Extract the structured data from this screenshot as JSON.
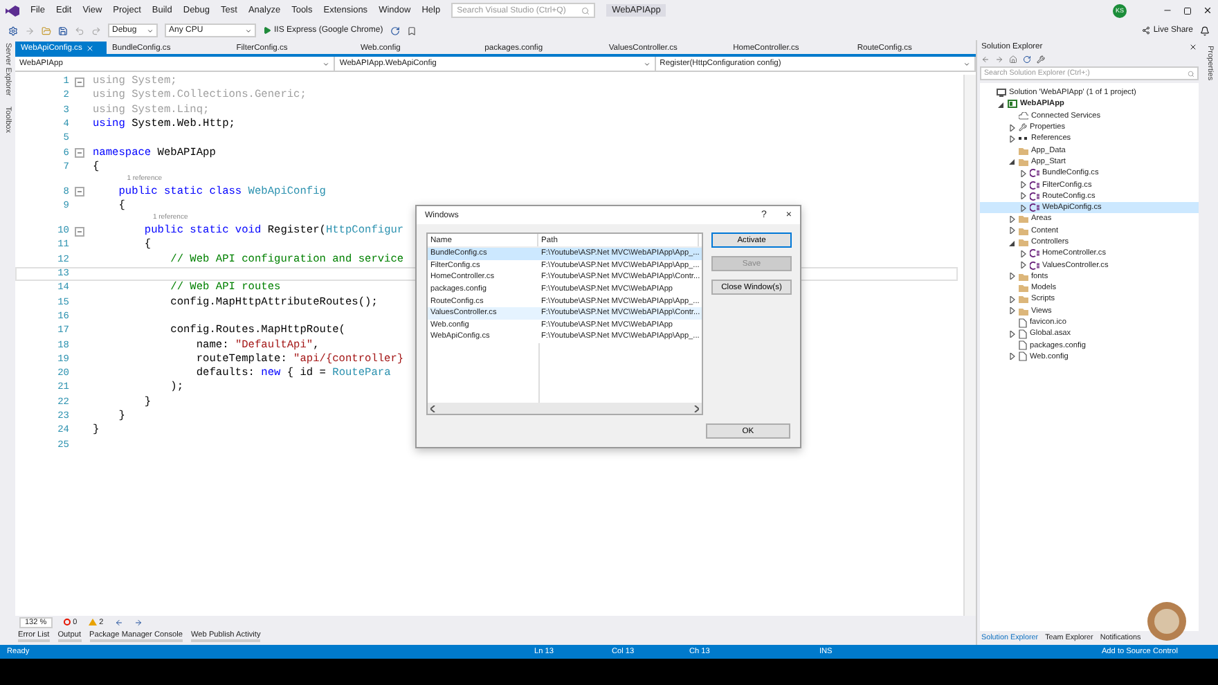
{
  "menu": [
    "File",
    "Edit",
    "View",
    "Project",
    "Build",
    "Debug",
    "Test",
    "Analyze",
    "Tools",
    "Extensions",
    "Window",
    "Help"
  ],
  "search": {
    "placeholder": "Search Visual Studio (Ctrl+Q)"
  },
  "window": {
    "title": "WebAPIApp"
  },
  "account": {
    "initials": "KS"
  },
  "live_share": "Live Share",
  "toolbar": {
    "configuration": "Debug",
    "platform": "Any CPU",
    "run": "IIS Express (Google Chrome)"
  },
  "side_tabs": [
    "Server Explorer",
    "Toolbox"
  ],
  "right_side_tabs": [
    "Properties"
  ],
  "tabs": [
    {
      "label": "WebApiConfig.cs",
      "selected": true
    },
    {
      "label": "BundleConfig.cs",
      "selected": false
    },
    {
      "label": "FilterConfig.cs",
      "selected": false
    },
    {
      "label": "Web.config",
      "selected": false
    },
    {
      "label": "packages.config",
      "selected": false
    },
    {
      "label": "ValuesController.cs",
      "selected": false
    },
    {
      "label": "HomeController.cs",
      "selected": false
    },
    {
      "label": "RouteConfig.cs",
      "selected": false
    }
  ],
  "nav_bar": {
    "project": "WebAPIApp",
    "type": "WebAPIApp.WebApiConfig",
    "member": "Register(HttpConfiguration config)"
  },
  "code": [
    {
      "n": "1",
      "fold": true,
      "segs": [
        {
          "t": "using System;",
          "kind": "dim"
        }
      ]
    },
    {
      "n": "2",
      "segs": [
        {
          "t": "using System.Collections.Generic;",
          "kind": "dim"
        }
      ]
    },
    {
      "n": "3",
      "segs": [
        {
          "t": "using System.Linq;",
          "kind": "dim"
        }
      ]
    },
    {
      "n": "4",
      "segs": [
        {
          "t": "using",
          "kind": "kw"
        },
        {
          "t": " System.Web.Http;",
          "kind": "plain"
        }
      ]
    },
    {
      "n": "5"
    },
    {
      "n": "6",
      "fold": true,
      "segs": [
        {
          "t": "namespace",
          "kind": "kw"
        },
        {
          "t": " WebAPIApp",
          "kind": "plain"
        }
      ]
    },
    {
      "n": "7",
      "segs": [
        {
          "t": "{",
          "kind": "plain"
        }
      ]
    },
    {
      "n": "8",
      "fold": true,
      "ref": "1 reference",
      "segs": [
        {
          "t": "    public static class ",
          "kind": "kw"
        },
        {
          "t": "WebApiConfig",
          "kind": "type"
        }
      ]
    },
    {
      "n": "9",
      "segs": [
        {
          "t": "    {",
          "kind": "plain"
        }
      ]
    },
    {
      "n": "10",
      "fold": true,
      "ref": "1 reference",
      "segs": [
        {
          "t": "        public static void",
          "kind": "kw"
        },
        {
          "t": " Register(",
          "kind": "plain"
        },
        {
          "t": "HttpConfigur",
          "kind": "type"
        }
      ]
    },
    {
      "n": "11",
      "segs": [
        {
          "t": "        {",
          "kind": "plain"
        }
      ]
    },
    {
      "n": "12",
      "segs": [
        {
          "t": "            // Web API configuration and service",
          "kind": "comment"
        }
      ]
    },
    {
      "n": "13",
      "current": true
    },
    {
      "n": "14",
      "segs": [
        {
          "t": "            // Web API routes",
          "kind": "comment"
        }
      ]
    },
    {
      "n": "15",
      "segs": [
        {
          "t": "            config.MapHttpAttributeRoutes();",
          "kind": "plain"
        }
      ]
    },
    {
      "n": "16"
    },
    {
      "n": "17",
      "segs": [
        {
          "t": "            config.Routes.MapHttpRoute(",
          "kind": "plain"
        }
      ]
    },
    {
      "n": "18",
      "segs": [
        {
          "t": "                name: ",
          "kind": "plain"
        },
        {
          "t": "\"DefaultApi\"",
          "kind": "string"
        },
        {
          "t": ",",
          "kind": "plain"
        }
      ]
    },
    {
      "n": "19",
      "segs": [
        {
          "t": "                routeTemplate: ",
          "kind": "plain"
        },
        {
          "t": "\"api/{controller}",
          "kind": "string"
        }
      ]
    },
    {
      "n": "20",
      "segs": [
        {
          "t": "                defaults: ",
          "kind": "plain"
        },
        {
          "t": "new",
          "kind": "kw"
        },
        {
          "t": " { id = ",
          "kind": "plain"
        },
        {
          "t": "RoutePara",
          "kind": "type"
        }
      ]
    },
    {
      "n": "21",
      "segs": [
        {
          "t": "            );",
          "kind": "plain"
        }
      ]
    },
    {
      "n": "22",
      "segs": [
        {
          "t": "        }",
          "kind": "plain"
        }
      ]
    },
    {
      "n": "23",
      "segs": [
        {
          "t": "    }",
          "kind": "plain"
        }
      ]
    },
    {
      "n": "24",
      "segs": [
        {
          "t": "}",
          "kind": "plain"
        }
      ]
    },
    {
      "n": "25"
    }
  ],
  "dialog": {
    "title": "Windows",
    "help": "?",
    "close": "×",
    "columns": [
      "Name",
      "Path"
    ],
    "rows": [
      {
        "name": "BundleConfig.cs",
        "path": "F:\\Youtube\\ASP.Net MVC\\WebAPIApp\\App_...",
        "selected": true,
        "hovered": false
      },
      {
        "name": "FilterConfig.cs",
        "path": "F:\\Youtube\\ASP.Net MVC\\WebAPIApp\\App_...",
        "selected": false,
        "hovered": false
      },
      {
        "name": "HomeController.cs",
        "path": "F:\\Youtube\\ASP.Net MVC\\WebAPIApp\\Contr...",
        "selected": false,
        "hovered": false
      },
      {
        "name": "packages.config",
        "path": "F:\\Youtube\\ASP.Net MVC\\WebAPIApp",
        "selected": false,
        "hovered": false
      },
      {
        "name": "RouteConfig.cs",
        "path": "F:\\Youtube\\ASP.Net MVC\\WebAPIApp\\App_...",
        "selected": false,
        "hovered": false
      },
      {
        "name": "ValuesController.cs",
        "path": "F:\\Youtube\\ASP.Net MVC\\WebAPIApp\\Contr...",
        "selected": false,
        "hovered": true
      },
      {
        "name": "Web.config",
        "path": "F:\\Youtube\\ASP.Net MVC\\WebAPIApp",
        "selected": false,
        "hovered": false
      },
      {
        "name": "WebApiConfig.cs",
        "path": "F:\\Youtube\\ASP.Net MVC\\WebAPIApp\\App_...",
        "selected": false,
        "hovered": false
      }
    ],
    "buttons": [
      {
        "label": "Activate",
        "disabled": false,
        "default": true
      },
      {
        "label": "Save",
        "disabled": true,
        "default": false
      },
      {
        "label": "Close Window(s)",
        "disabled": false,
        "default": false
      }
    ],
    "ok": "OK"
  },
  "editor_status": {
    "zoom": "132 %",
    "errors": "0",
    "warnings": "2"
  },
  "bottom_tabs": [
    "Error List",
    "Output",
    "Package Manager Console",
    "Web Publish Activity"
  ],
  "solution_explorer": {
    "title": "Solution Explorer",
    "search": {
      "placeholder": "Search Solution Explorer (Ctrl+;)"
    },
    "tree": [
      {
        "label": "Solution 'WebAPIApp' (1 of 1 project)",
        "kind": "solution",
        "selected": false,
        "children": [
          {
            "label": "WebAPIApp",
            "kind": "project",
            "bold": true,
            "expanded": true,
            "selected": false,
            "children": [
              {
                "label": "Connected Services",
                "kind": "connected",
                "selected": false
              },
              {
                "label": "Properties",
                "kind": "wrench",
                "expanded": false,
                "selected": false
              },
              {
                "label": "References",
                "kind": "references",
                "expanded": false,
                "selected": false
              },
              {
                "label": "App_Data",
                "kind": "folder",
                "selected": false
              },
              {
                "label": "App_Start",
                "kind": "openfolder",
                "expanded": true,
                "selected": false,
                "children": [
                  {
                    "label": "BundleConfig.cs",
                    "kind": "csharp",
                    "expanded": false,
                    "selected": false
                  },
                  {
                    "label": "FilterConfig.cs",
                    "kind": "csharp",
                    "expanded": false,
                    "selected": false
                  },
                  {
                    "label": "RouteConfig.cs",
                    "kind": "csharp",
                    "expanded": false,
                    "selected": false
                  },
                  {
                    "label": "WebApiConfig.cs",
                    "kind": "csharp",
                    "expanded": false,
                    "selected": true
                  }
                ]
              },
              {
                "label": "Areas",
                "kind": "folder",
                "expanded": false,
                "selected": false
              },
              {
                "label": "Content",
                "kind": "folder",
                "expanded": false,
                "selected": false
              },
              {
                "label": "Controllers",
                "kind": "openfolder",
                "expanded": true,
                "selected": false,
                "children": [
                  {
                    "label": "HomeController.cs",
                    "kind": "csharp",
                    "expanded": false,
                    "selected": false
                  },
                  {
                    "label": "ValuesController.cs",
                    "kind": "csharp",
                    "expanded": false,
                    "selected": false
                  }
                ]
              },
              {
                "label": "fonts",
                "kind": "folder",
                "expanded": false,
                "selected": false
              },
              {
                "label": "Models",
                "kind": "folder",
                "selected": false
              },
              {
                "label": "Scripts",
                "kind": "folder",
                "expanded": false,
                "selected": false
              },
              {
                "label": "Views",
                "kind": "folder",
                "expanded": false,
                "selected": false
              },
              {
                "label": "favicon.ico",
                "kind": "file",
                "selected": false
              },
              {
                "label": "Global.asax",
                "kind": "global",
                "expanded": false,
                "selected": false
              },
              {
                "label": "packages.config",
                "kind": "config",
                "selected": false
              },
              {
                "label": "Web.config",
                "kind": "config",
                "expanded": false,
                "selected": false
              }
            ]
          }
        ]
      }
    ],
    "tabs": [
      {
        "label": "Solution Explorer",
        "selected": true
      },
      {
        "label": "Team Explorer",
        "selected": false
      },
      {
        "label": "Notifications",
        "selected": false
      }
    ]
  },
  "status_bar": {
    "state": "Ready",
    "ln": "Ln 13",
    "col": "Col 13",
    "ch": "Ch 13",
    "mode": "INS",
    "source_control": "Add to Source Control"
  }
}
